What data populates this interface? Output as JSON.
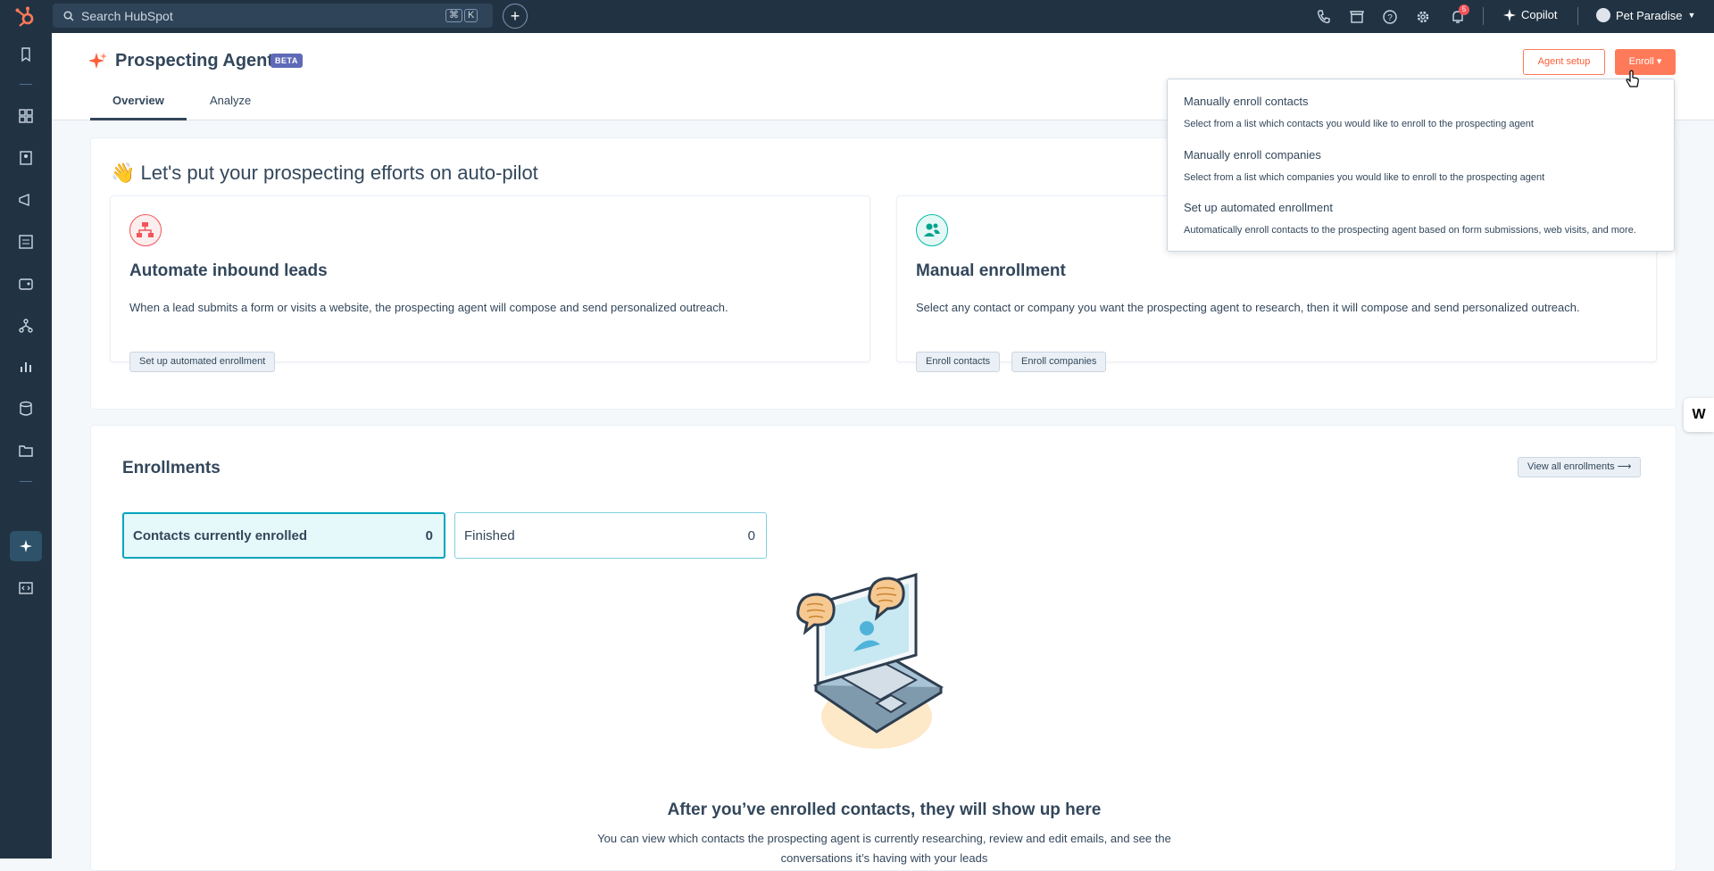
{
  "topbar": {
    "search_placeholder": "Search HubSpot",
    "kbd_cmd": "⌘",
    "kbd_k": "K",
    "create_label": "+",
    "notification_count": "5",
    "copilot_label": "Copilot",
    "account_name": "Pet Paradise",
    "icons": [
      "phone-icon",
      "marketplace-icon",
      "help-icon",
      "settings-icon",
      "notifications-icon"
    ]
  },
  "sidebar": {
    "items": [
      "bookmarks-icon",
      "workspaces-icon",
      "contacts-icon",
      "marketing-icon",
      "content-icon",
      "commerce-icon",
      "automation-icon",
      "reporting-icon",
      "data-icon",
      "library-icon",
      "agents-icon",
      "development-icon"
    ]
  },
  "header": {
    "title": "Prospecting Agent",
    "badge": "BETA",
    "tabs": [
      {
        "label": "Overview",
        "active": true
      },
      {
        "label": "Analyze",
        "active": false
      }
    ],
    "agent_setup_label": "Agent setup",
    "enroll_label": "Enroll ▾"
  },
  "intro": {
    "heading": "👋 Let's put your prospecting efforts on auto-pilot",
    "cards": [
      {
        "title": "Automate inbound leads",
        "description": "When a lead submits a form or visits a website, the prospecting agent will compose and send personalized outreach.",
        "buttons": [
          "Set up automated enrollment"
        ]
      },
      {
        "title": "Manual enrollment",
        "description": "Select any contact or company you want the prospecting agent to research, then it will compose and send personalized outreach.",
        "buttons": [
          "Enroll contacts",
          "Enroll companies"
        ]
      }
    ]
  },
  "enrollments": {
    "title": "Enrollments",
    "view_all_label": "View all enrollments ⟶",
    "stats": [
      {
        "label": "Contacts currently enrolled",
        "value": "0"
      },
      {
        "label": "Finished",
        "value": "0"
      }
    ],
    "empty_title": "After you’ve enrolled contacts, they will show up here",
    "empty_line1": "You can view which contacts the prospecting agent is currently researching, review and edit emails, and see the",
    "empty_line2": "conversations it’s having with your leads"
  },
  "dropdown": {
    "items": [
      {
        "title": "Manually enroll contacts",
        "description": "Select from a list which contacts you would like to enroll to the prospecting agent"
      },
      {
        "title": "Manually enroll companies",
        "description": "Select from a list which companies you would like to enroll to the prospecting agent"
      },
      {
        "title": "Set up automated enrollment",
        "description": "Automatically enroll contacts to the prospecting agent based on form submissions, web visits, and more."
      }
    ]
  },
  "widget_label": "W",
  "colors": {
    "accent": "#ff7a59",
    "nav": "#213343",
    "teal": "#00a4bd"
  }
}
